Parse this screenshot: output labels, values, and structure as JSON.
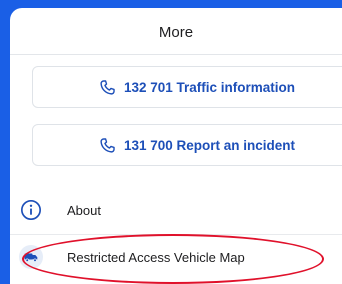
{
  "header": {
    "title": "More"
  },
  "call_buttons": [
    {
      "label": "132 701 Traffic information",
      "icon": "phone-icon"
    },
    {
      "label": "131 700 Report an incident",
      "icon": "phone-icon"
    }
  ],
  "menu": [
    {
      "label": "About",
      "icon": "info-icon"
    },
    {
      "label": "Restricted Access Vehicle Map",
      "icon": "truck-icon"
    }
  ],
  "colors": {
    "background_blue": "#1a5fe6",
    "link_blue": "#1d4fb8",
    "highlight_red": "#e0112b"
  }
}
